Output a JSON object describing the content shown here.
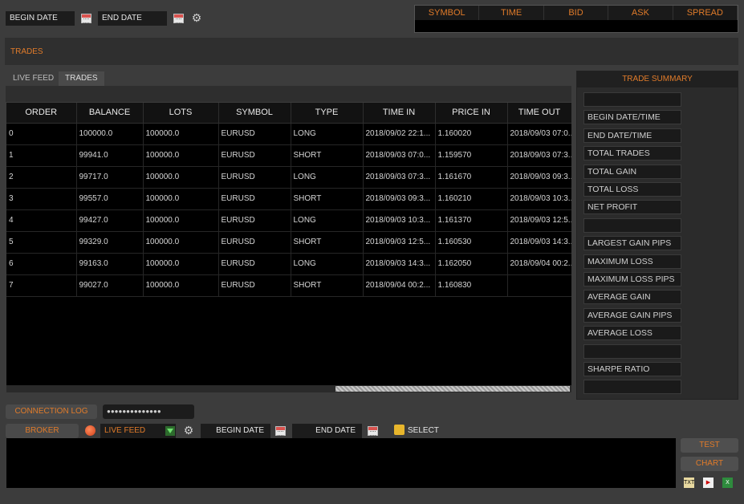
{
  "top_bar": {
    "begin_date": "BEGIN DATE",
    "end_date": "END DATE"
  },
  "quote_header": {
    "columns": [
      "SYMBOL",
      "TIME",
      "BID",
      "ASK",
      "SPREAD"
    ]
  },
  "trades_label": "TRADES",
  "tabs": [
    "LIVE FEED",
    "TRADES"
  ],
  "table": {
    "columns": [
      "ORDER",
      "BALANCE",
      "LOTS",
      "SYMBOL",
      "TYPE",
      "TIME IN",
      "PRICE IN",
      "TIME OUT"
    ],
    "rows": [
      [
        "0",
        "100000.0",
        "100000.0",
        "EURUSD",
        "LONG",
        "2018/09/02 22:1...",
        "1.160020",
        "2018/09/03 07:0..."
      ],
      [
        "1",
        "99941.0",
        "100000.0",
        "EURUSD",
        "SHORT",
        "2018/09/03 07:0...",
        "1.159570",
        "2018/09/03 07:3..."
      ],
      [
        "2",
        "99717.0",
        "100000.0",
        "EURUSD",
        "LONG",
        "2018/09/03 07:3...",
        "1.161670",
        "2018/09/03 09:3..."
      ],
      [
        "3",
        "99557.0",
        "100000.0",
        "EURUSD",
        "SHORT",
        "2018/09/03 09:3...",
        "1.160210",
        "2018/09/03 10:3..."
      ],
      [
        "4",
        "99427.0",
        "100000.0",
        "EURUSD",
        "LONG",
        "2018/09/03 10:3...",
        "1.161370",
        "2018/09/03 12:5..."
      ],
      [
        "5",
        "99329.0",
        "100000.0",
        "EURUSD",
        "SHORT",
        "2018/09/03 12:5...",
        "1.160530",
        "2018/09/03 14:3..."
      ],
      [
        "6",
        "99163.0",
        "100000.0",
        "EURUSD",
        "LONG",
        "2018/09/03 14:3...",
        "1.162050",
        "2018/09/04 00:2..."
      ],
      [
        "7",
        "99027.0",
        "100000.0",
        "EURUSD",
        "SHORT",
        "2018/09/04 00:2...",
        "1.160830",
        ""
      ]
    ]
  },
  "summary": {
    "title": "TRADE SUMMARY",
    "items": [
      "",
      "BEGIN DATE/TIME",
      "END DATE/TIME",
      "TOTAL TRADES",
      "TOTAL GAIN",
      "TOTAL LOSS",
      "NET PROFIT",
      "",
      "LARGEST GAIN PIPS",
      "MAXIMUM LOSS",
      "MAXIMUM LOSS PIPS",
      "AVERAGE GAIN",
      "AVERAGE GAIN PIPS",
      "AVERAGE LOSS",
      "",
      "SHARPE RATIO",
      ""
    ]
  },
  "bottom": {
    "connection_log": "CONNECTION LOG",
    "password_mask": "●●●●●●●●●●●●●●",
    "broker": "BROKER",
    "feed_select": "LIVE FEED",
    "begin_date": "BEGIN DATE",
    "end_date": "END DATE",
    "select_label": "SELECT",
    "test_button": "TEST",
    "chart_button": "CHART",
    "icons": [
      "txt-file-icon",
      "pdf-file-icon",
      "excel-file-icon"
    ]
  },
  "colors": {
    "accent": "#e07b2a",
    "background": "#3c3c3c",
    "panel_black": "#000000"
  }
}
